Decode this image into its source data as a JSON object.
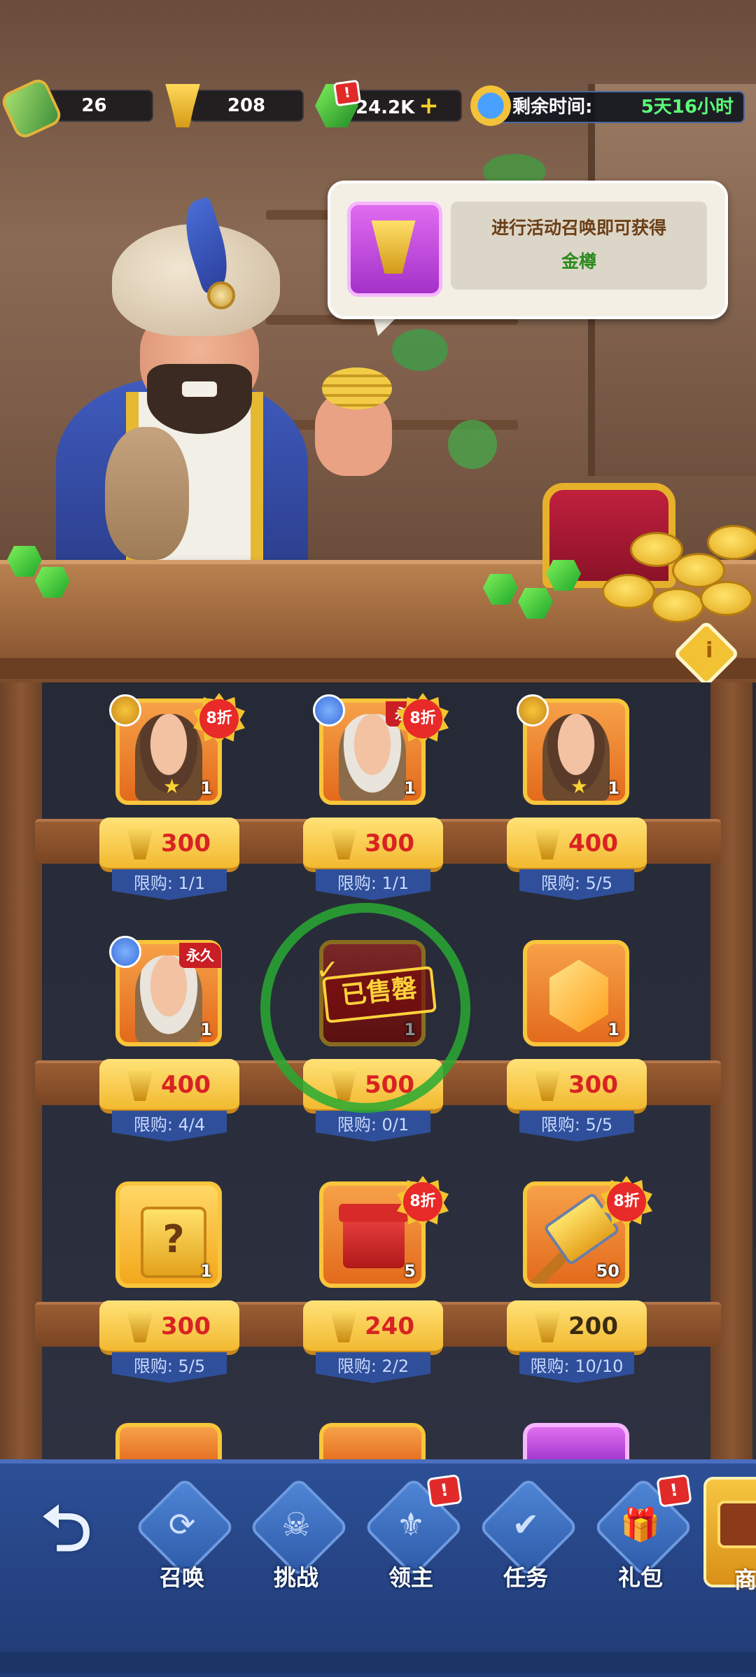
{
  "hud": {
    "scrolls": "26",
    "golden_cups": "208",
    "gems": "24.2K",
    "gems_plus": "+",
    "gems_badge": "!",
    "timer_label": "剩余时间:",
    "timer_value": "5天16小时"
  },
  "bubble": {
    "line1": "进行活动召唤即可获得",
    "line2": "金樽"
  },
  "shop": {
    "items": [
      {
        "sale": "8折",
        "qty": "1",
        "price": "300",
        "limit": "限购: 1/1"
      },
      {
        "sale": "8折",
        "perm": "永",
        "qty": "1",
        "price": "300",
        "limit": "限购: 1/1"
      },
      {
        "qty": "1",
        "price": "400",
        "limit": "限购: 5/5"
      },
      {
        "perm": "永久",
        "qty": "1",
        "price": "400",
        "limit": "限购: 4/4"
      },
      {
        "soldout": "已售罄",
        "qty": "1",
        "price": "500",
        "limit": "限购: 0/1"
      },
      {
        "qty": "1",
        "price": "300",
        "limit": "限购: 5/5"
      },
      {
        "qty": "1",
        "mystery": "?",
        "price": "300",
        "limit": "限购: 5/5"
      },
      {
        "sale": "8折",
        "qty": "5",
        "price": "240",
        "limit": "限购: 2/2"
      },
      {
        "sale": "8折",
        "qty": "50",
        "price": "200",
        "limit": "限购: 10/10"
      }
    ]
  },
  "info_button": "i",
  "nav": {
    "back_glyph": "⮌",
    "items": [
      {
        "label": "召唤",
        "glyph": "⟳"
      },
      {
        "label": "挑战",
        "glyph": "☠"
      },
      {
        "label": "领主",
        "glyph": "⚜",
        "badge": "!"
      },
      {
        "label": "任务",
        "glyph": "✔"
      },
      {
        "label": "礼包",
        "glyph": "🎁",
        "badge": "!"
      }
    ],
    "shop_label": "商"
  }
}
